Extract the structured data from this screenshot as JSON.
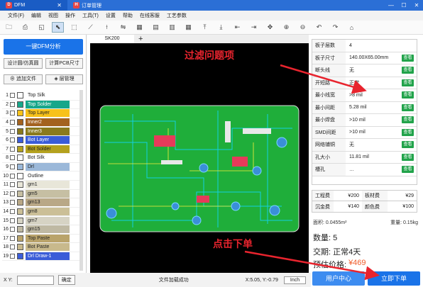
{
  "titlebar": {
    "tab1": "DFM",
    "tab2": "订单管理",
    "close": "✕",
    "min": "—",
    "max": "☐",
    "cls": "✕"
  },
  "menu": [
    "文件(F)",
    "编辑",
    "视图",
    "操作",
    "工具(T)",
    "设置",
    "帮助",
    "在线客服",
    "工艺参数"
  ],
  "left": {
    "dfm_button": "一键DFM分析",
    "design_rule": "设计圆/仿真圆",
    "calc_pcb": "计算PCB尺寸",
    "add_file": "追加文件",
    "layer_mgr": "层管理"
  },
  "layers": [
    {
      "n": "1",
      "name": "Top Silk",
      "color": "#ffffff"
    },
    {
      "n": "2",
      "name": "Top Solder",
      "color": "#17a78a"
    },
    {
      "n": "3",
      "name": "Top Layer",
      "color": "#f7c21a"
    },
    {
      "n": "4",
      "name": "Inner2",
      "color": "#a3621f"
    },
    {
      "n": "5",
      "name": "Inner3",
      "color": "#8a7a1d"
    },
    {
      "n": "6",
      "name": "Bot Layer",
      "color": "#3a5cd8"
    },
    {
      "n": "7",
      "name": "Bot Solder",
      "color": "#b4a11e"
    },
    {
      "n": "8",
      "name": "Bot Silk",
      "color": "#ffffff"
    },
    {
      "n": "9",
      "name": "Drl",
      "color": "#9bb8d9"
    },
    {
      "n": "10",
      "name": "Outline",
      "color": "#ffffff"
    },
    {
      "n": "11",
      "name": "gm1",
      "color": "#e8e6d9"
    },
    {
      "n": "12",
      "name": "gm5",
      "color": "#c6bfa3"
    },
    {
      "n": "13",
      "name": "gm13",
      "color": "#b9a887"
    },
    {
      "n": "14",
      "name": "gm8",
      "color": "#cbbf97"
    },
    {
      "n": "15",
      "name": "gm7",
      "color": "#d6d3c4"
    },
    {
      "n": "16",
      "name": "gm15",
      "color": "#bfb9a3"
    },
    {
      "n": "17",
      "name": "Top Paste",
      "color": "#b9a36a"
    },
    {
      "n": "18",
      "name": "Bot Paste",
      "color": "#c8b98c"
    },
    {
      "n": "19",
      "name": "Drl Draw-1",
      "color": "#3a5cd8"
    }
  ],
  "canvas_tab": "SK200",
  "props": [
    {
      "k": "板子层数",
      "v": "4",
      "check": ""
    },
    {
      "k": "板子尺寸",
      "v": "140.00X65.00mm",
      "check": "查看"
    },
    {
      "k": "断头线",
      "v": "无",
      "check": "查看"
    },
    {
      "k": "开短路",
      "v": "正常",
      "check": "查看"
    },
    {
      "k": "最小线宽",
      "v": ">8 mil",
      "check": "查看"
    },
    {
      "k": "最小间距",
      "v": "5.28 mil",
      "check": "查看"
    },
    {
      "k": "最小焊盘",
      "v": ">10 mil",
      "check": "查看"
    },
    {
      "k": "SMD间距",
      "v": ">10 mil",
      "check": "查看"
    },
    {
      "k": "网络铺铜",
      "v": "无",
      "check": "查看"
    },
    {
      "k": "孔大小",
      "v": "11.81 mil",
      "check": "查看"
    },
    {
      "k": "槽孔",
      "v": "…",
      "check": "查看"
    }
  ],
  "fees": [
    {
      "a": "工程费",
      "b": "¥200",
      "c": "板材费",
      "d": "¥29"
    },
    {
      "a": "沉金费",
      "b": "¥140",
      "c": "颜色费",
      "d": "¥100"
    }
  ],
  "area": "面积: 0.0455m²",
  "weight": "重量: 0.15kg",
  "qty": "数量: 5",
  "lead": "交期: 正常4天",
  "price_label": "预估价格:",
  "price": "¥469",
  "btn_uc": "用户中心",
  "btn_order": "立即下单",
  "status": {
    "xy": "X Y:",
    "ok": "确定",
    "msg": "文件加载成功",
    "coord": "X:5.05, Y:-0.79",
    "unit": "Inch"
  },
  "annotations": {
    "filter": "过滤问题项",
    "click": "点击下单"
  },
  "colors": {
    "board": "#1fae3a",
    "accent": "#1a73e8",
    "price": "#f05a28",
    "ann": "#e8242e"
  }
}
